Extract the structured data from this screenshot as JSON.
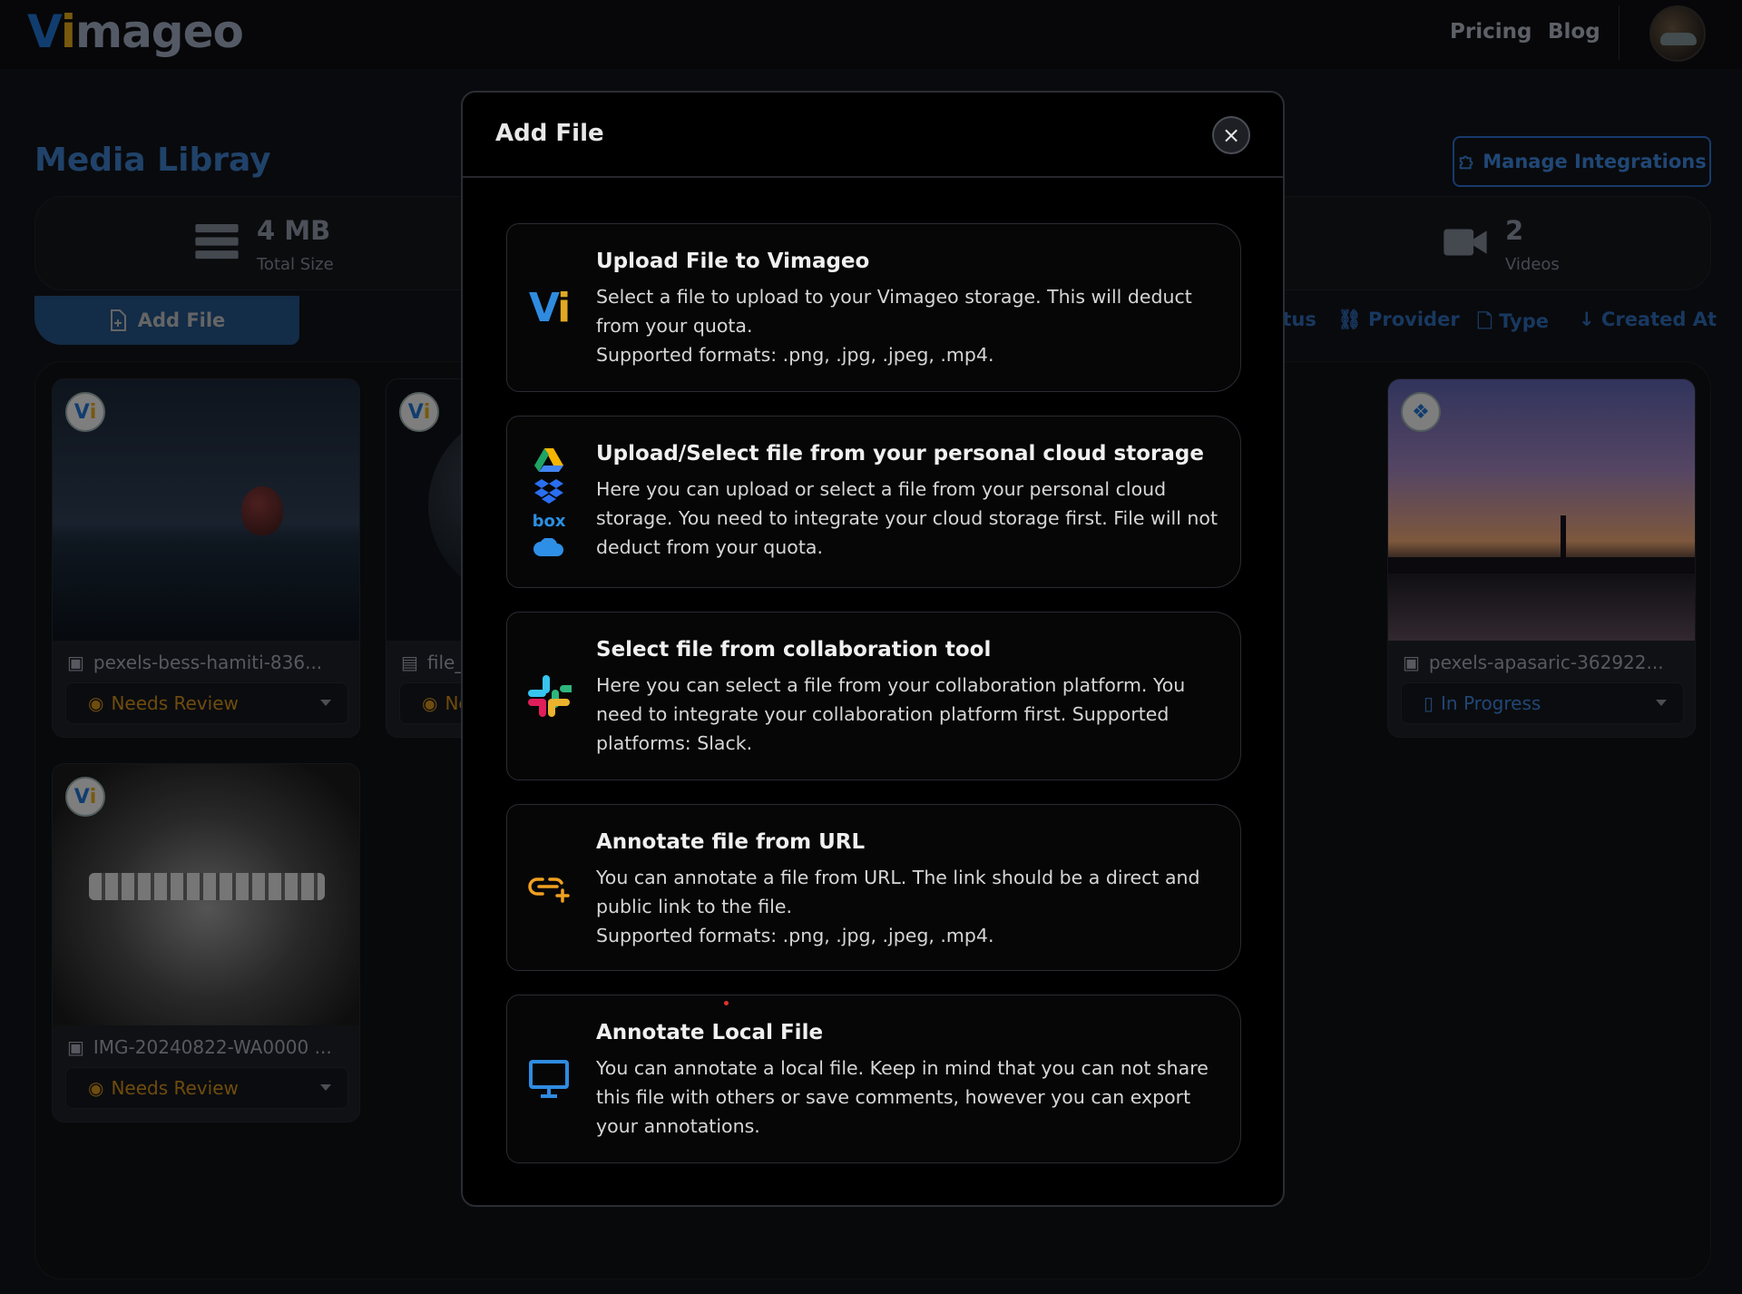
{
  "brand": {
    "logo_v": "V",
    "logo_i": "i",
    "logo_rest": "mageo"
  },
  "nav": {
    "pricing": "Pricing",
    "blog": "Blog"
  },
  "page": {
    "title": "Media Libray",
    "manage_integrations": "Manage Integrations",
    "add_file": "Add File"
  },
  "stats": {
    "total_size": {
      "value": "4 MB",
      "label": "Total Size"
    },
    "videos": {
      "value": "2",
      "label": "Videos"
    }
  },
  "filters": {
    "status": "Status",
    "provider": "Provider",
    "type": "Type",
    "created_at": "Created At"
  },
  "cards": [
    {
      "filename": "pexels-bess-hamiti-836...",
      "status": "Needs Review"
    },
    {
      "filename": "file_exa",
      "status": "Needs"
    },
    {
      "filename": "pexels-apasaric-362922...",
      "status": "In Progress"
    },
    {
      "filename": "IMG-20240822-WA0000 ...",
      "status": "Needs Review"
    }
  ],
  "modal": {
    "title": "Add File",
    "close": "×",
    "options": [
      {
        "title": "Upload File to Vimageo",
        "description": "Select a file to upload to your Vimageo storage. This will deduct from your quota.",
        "formats": "Supported formats: .png, .jpg, .jpeg, .mp4."
      },
      {
        "title": "Upload/Select file from your personal cloud storage",
        "description": "Here you can upload or select a file from your personal cloud storage. You need to integrate your cloud storage first. File will not deduct from your quota."
      },
      {
        "title": "Select file from collaboration tool",
        "description": "Here you can select a file from your collaboration platform. You need to integrate your collaboration platform first. Supported platforms: Slack."
      },
      {
        "title": "Annotate file from URL",
        "description": "You can annotate a file from URL. The link should be a direct and public link to the file.",
        "formats": "Supported formats: .png, .jpg, .jpeg, .mp4."
      },
      {
        "title": "Annotate Local File",
        "description": "You can annotate a local file. Keep in mind that you can not share this file with others or save comments, however you can export your annotations."
      }
    ],
    "box_label": "box"
  },
  "colors": {
    "accent": "#2b6bb0",
    "review": "#c98a1a",
    "progress": "#3b82d6"
  }
}
